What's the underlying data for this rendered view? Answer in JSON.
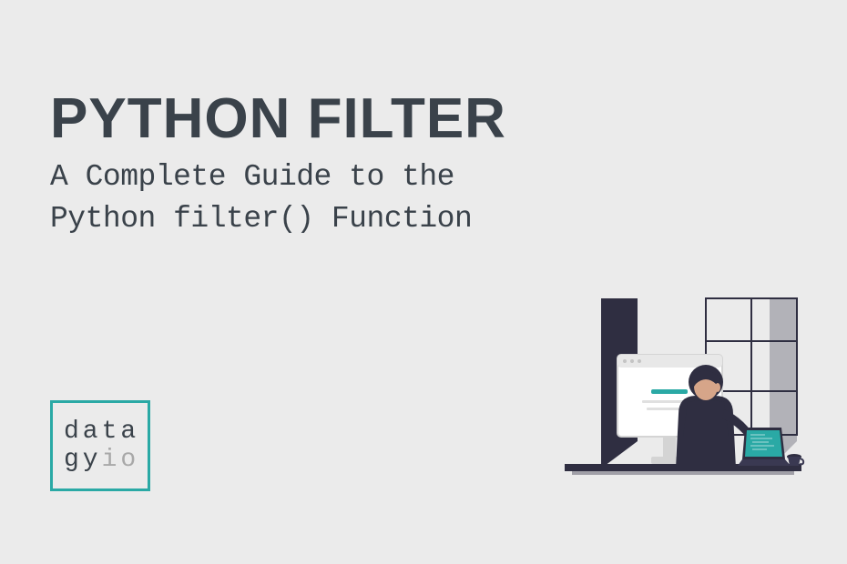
{
  "heading": {
    "title": "PYTHON FILTER",
    "subtitle_line1": "A Complete Guide to the",
    "subtitle_line2": "Python filter() Function"
  },
  "logo": {
    "line1": "data",
    "line2_part1": "gy",
    "line2_part2": "io"
  },
  "colors": {
    "background": "#ebebeb",
    "text": "#3a424a",
    "accent": "#2aa9a5",
    "muted": "#a8a8a8",
    "illustration_dark": "#2f2e41",
    "illustration_skin": "#d6a589"
  },
  "illustration": {
    "description": "person-at-computer-desk"
  }
}
